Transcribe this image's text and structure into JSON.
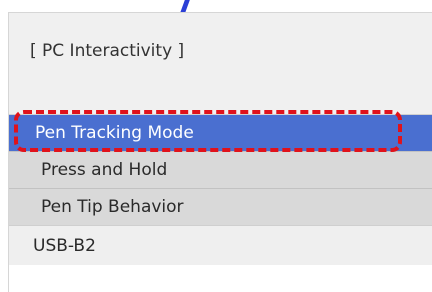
{
  "section": {
    "title": "[ PC Interactivity ]"
  },
  "menu": {
    "items": [
      {
        "label": "Pen Tracking Mode",
        "selected": true
      },
      {
        "label": "Press and Hold",
        "selected": false
      },
      {
        "label": "Pen Tip Behavior",
        "selected": false
      },
      {
        "label": "USB-B2",
        "selected": false
      }
    ]
  },
  "colors": {
    "selected_bg": "#4a6fd0",
    "item_bg": "#d9d9d9",
    "highlight": "#e0121b"
  },
  "icons": {
    "top_mark": "pointer-stroke"
  }
}
